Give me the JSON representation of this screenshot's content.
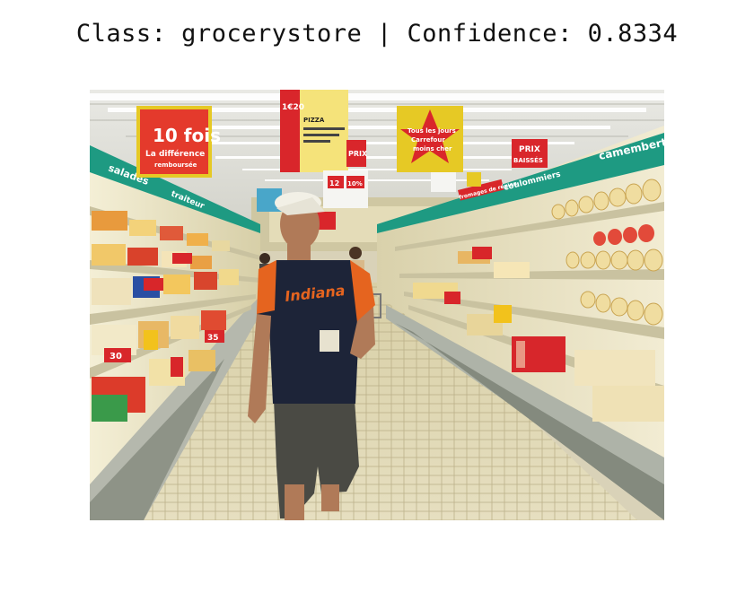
{
  "header": {
    "title": "Class: grocerystore | Confidence: 0.8334"
  },
  "image": {
    "scene": "supermarket-aisle",
    "signs": {
      "left_big": "10 fois",
      "left_big_sub": "La différence",
      "left_big_sub2": "remboursée",
      "center_price": "1€20",
      "center_pizza": "PIZZA",
      "right_star": "Tous les jours",
      "right_star2": "Carrefour",
      "right_star3": "moins cher",
      "prix_baisses_1": "PRIX",
      "prix_baisses_2": "BAISSÉS",
      "prix_mid": "PRIX",
      "pct_10": "10%",
      "num_12": "12",
      "left_rail": "salades",
      "left_rail2": "traiteur",
      "right_rail": "camembert au",
      "right_rail2": "coulommiers",
      "right_rail3": "fromages de région",
      "shirt": "Indiana",
      "tag_30": "30",
      "tag_35": "35"
    }
  }
}
